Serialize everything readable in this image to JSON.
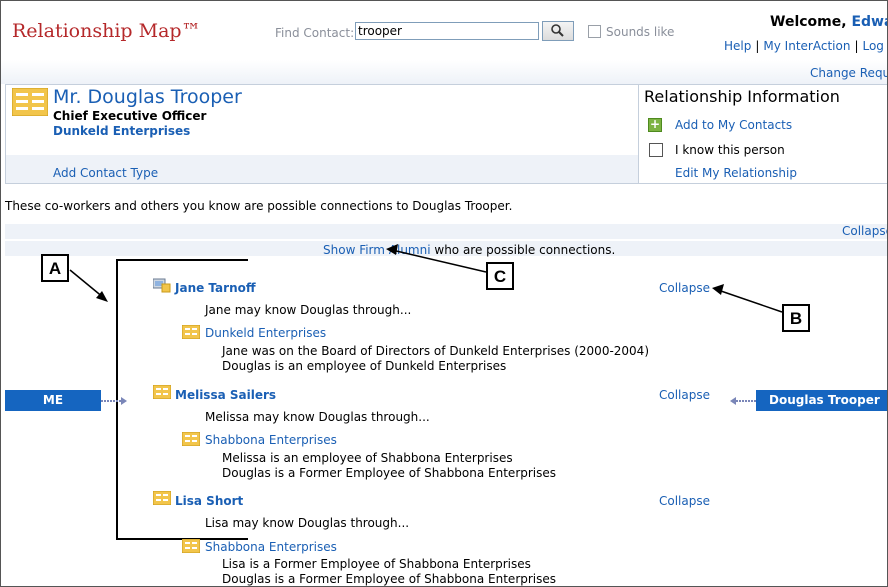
{
  "header": {
    "app_title": "Relationship Map™",
    "find_label": "Find Contact:",
    "find_value": "trooper",
    "sounds_like": "Sounds like",
    "welcome_prefix": "Welcome, ",
    "welcome_name": "Edwa",
    "links": [
      "Help",
      "My InterAction",
      "Log O"
    ],
    "change_request": "Change Reque"
  },
  "contact": {
    "name": "Mr. Douglas Trooper",
    "title": "Chief Executive Officer",
    "company": "Dunkeld Enterprises",
    "add_contact_type": "Add Contact Type"
  },
  "relationship": {
    "title": "Relationship Information",
    "add_to_contacts": "Add to My Contacts",
    "i_know": "I know this person",
    "edit": "Edit My Relationship"
  },
  "intro_text": "These co-workers and others you know are possible connections to Douglas Trooper.",
  "band_collapse": "Collapse",
  "show_alumni": {
    "link": "Show Firm Alumni",
    "rest": " who are possible connections."
  },
  "map": {
    "me_label": "ME",
    "target_label": "Douglas Trooper",
    "connections": [
      {
        "name": "Jane Tarnoff",
        "collapse": "Collapse",
        "may_know": "Jane may know Douglas through...",
        "company": "Dunkeld Enterprises",
        "details": [
          "Jane was on the Board of Directors of Dunkeld Enterprises (2000-2004)",
          "Douglas is an employee of Dunkeld Enterprises"
        ]
      },
      {
        "name": "Melissa Sailers",
        "collapse": "Collapse",
        "may_know": "Melissa may know Douglas through...",
        "company": "Shabbona Enterprises",
        "details": [
          "Melissa is an employee of Shabbona Enterprises",
          "Douglas is a Former Employee of Shabbona Enterprises"
        ]
      },
      {
        "name": "Lisa Short",
        "collapse": "Collapse",
        "may_know": "Lisa may know Douglas through...",
        "company": "Shabbona Enterprises",
        "details": [
          "Lisa is a Former Employee of Shabbona Enterprises",
          "Douglas is a Former Employee of Shabbona Enterprises"
        ]
      }
    ]
  },
  "callouts": {
    "a": "A",
    "b": "B",
    "c": "C"
  },
  "colors": {
    "brand_red": "#b5282a",
    "link_blue": "#1a5fb4",
    "me_blue": "#1565c0",
    "band": "#eef2f8"
  }
}
